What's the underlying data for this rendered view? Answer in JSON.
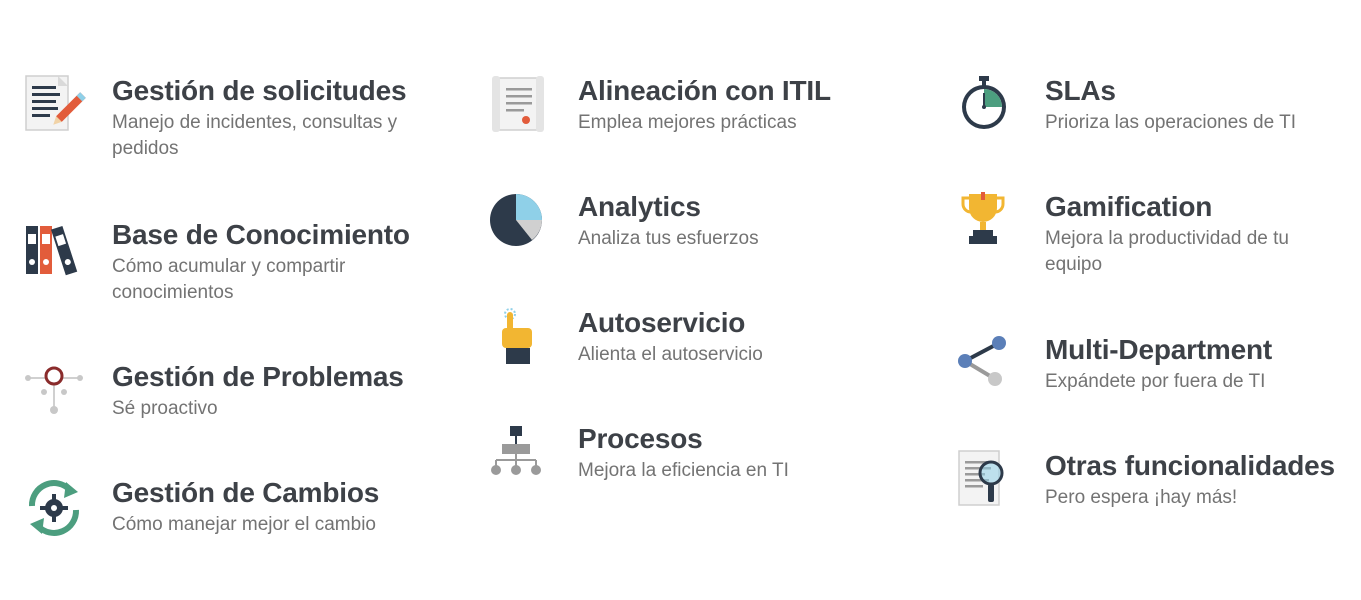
{
  "columns": [
    {
      "items": [
        {
          "title": "Gestión de solicitudes",
          "desc": "Manejo de incidentes, consultas y pedidos",
          "icon": "document-pencil-icon"
        },
        {
          "title": "Base de Conocimiento",
          "desc": "Cómo acumular y compartir conocimientos",
          "icon": "binders-icon"
        },
        {
          "title": "Gestión de Problemas",
          "desc": "Sé proactivo",
          "icon": "problem-node-icon"
        },
        {
          "title": "Gestión de Cambios",
          "desc": "Cómo manejar mejor el cambio",
          "icon": "change-cycle-gear-icon"
        }
      ]
    },
    {
      "items": [
        {
          "title": "Alineación con ITIL",
          "desc": "Emplea mejores prácticas",
          "icon": "certificate-icon"
        },
        {
          "title": "Analytics",
          "desc": "Analiza tus esfuerzos",
          "icon": "pie-chart-icon"
        },
        {
          "title": "Autoservicio",
          "desc": "Alienta el autoservicio",
          "icon": "pointing-hand-icon"
        },
        {
          "title": "Procesos",
          "desc": "Mejora la eficiencia en TI",
          "icon": "flowchart-icon"
        }
      ]
    },
    {
      "items": [
        {
          "title": "SLAs",
          "desc": "Prioriza las operaciones de TI",
          "icon": "stopwatch-icon"
        },
        {
          "title": "Gamification",
          "desc": "Mejora la productividad de tu equipo",
          "icon": "trophy-icon"
        },
        {
          "title": "Multi-Department",
          "desc": "Expándete por fuera de TI",
          "icon": "share-nodes-icon"
        },
        {
          "title": "Otras funcionalidades",
          "desc": "Pero espera ¡hay más!",
          "icon": "document-magnifier-icon"
        }
      ]
    }
  ],
  "colors": {
    "title": "#3d4147",
    "desc": "#737373",
    "accent_red": "#e25c3b",
    "accent_blue": "#8fd0e8",
    "dark": "#2d3a4a",
    "green": "#4c9e7f",
    "gold": "#f2b632"
  }
}
